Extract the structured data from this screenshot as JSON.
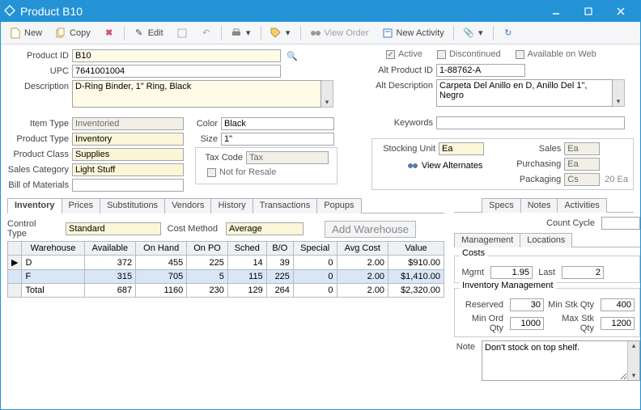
{
  "window": {
    "title": "Product B10"
  },
  "toolbar": {
    "new_": "New",
    "copy": "Copy",
    "edit": "Edit",
    "view_order": "View Order",
    "new_activity": "New Activity"
  },
  "labels": {
    "product_id": "Product ID",
    "upc": "UPC",
    "description": "Description",
    "item_type": "Item Type",
    "product_type": "Product Type",
    "product_class": "Product Class",
    "sales_category": "Sales Category",
    "bill_of_materials": "Bill of Materials",
    "color": "Color",
    "size": "Size",
    "tax_code": "Tax Code",
    "not_for_resale": "Not for Resale",
    "alt_product_id": "Alt Product ID",
    "alt_description": "Alt Description",
    "keywords": "Keywords",
    "active": "Active",
    "discontinued": "Discontinued",
    "avail_web": "Available on Web",
    "stocking_unit": "Stocking Unit",
    "sales": "Sales",
    "purchasing": "Purchasing",
    "packaging": "Packaging",
    "view_alternates": "View Alternates",
    "control_type": "Control Type",
    "cost_method": "Cost Method",
    "add_warehouse": "Add Warehouse",
    "count_cycle": "Count Cycle",
    "costs": "Costs",
    "mgmt": "Mgmt",
    "last": "Last",
    "inventory_mgmt": "Inventory Management",
    "reserved": "Reserved",
    "min_stk": "Min Stk Qty",
    "min_ord": "Min Ord Qty",
    "max_stk": "Max Stk Qty",
    "note": "Note"
  },
  "values": {
    "product_id": "B10",
    "upc": "7641001004",
    "description": "D-Ring Binder, 1\" Ring, Black",
    "item_type": "Inventoried",
    "product_type": "Inventory",
    "product_class": "Supplies",
    "sales_category": "Light Stuff",
    "bill_of_materials": "",
    "color": "Black",
    "size": "1\"",
    "tax_code": "Tax",
    "alt_product_id": "1-88762-A",
    "alt_description": "Carpeta Del Anillo en D, Anillo Del 1\", Negro",
    "keywords": "",
    "stocking_unit": "Ea",
    "sales": "Ea",
    "purchasing": "Ea",
    "packaging": "Cs",
    "packaging_qty": "20 Ea",
    "control_type": "Standard",
    "cost_method": "Average",
    "count_cycle": "",
    "mgmt": "1.95",
    "last": "2",
    "reserved": "30",
    "min_stk": "400",
    "min_ord": "1000",
    "max_stk": "1200",
    "note": "Don't stock on top shelf."
  },
  "checks": {
    "active": true,
    "discontinued": false,
    "avail_web": false,
    "not_for_resale": false
  },
  "tabs": [
    "Inventory",
    "Prices",
    "Substitutions",
    "Vendors",
    "History",
    "Transactions",
    "Popups"
  ],
  "right_tabs": [
    "Specs",
    "Notes",
    "Activities"
  ],
  "mgmt_tabs": [
    "Management",
    "Locations"
  ],
  "grid": {
    "cols": [
      "Warehouse",
      "Available",
      "On Hand",
      "On PO",
      "Sched",
      "B/O",
      "Special",
      "Avg Cost",
      "Value"
    ],
    "rows": [
      {
        "sel": "cur",
        "c": [
          "D",
          "372",
          "455",
          "225",
          "14",
          "39",
          "0",
          "2.00",
          "$910.00"
        ]
      },
      {
        "sel": "hi",
        "c": [
          "F",
          "315",
          "705",
          "5",
          "115",
          "225",
          "0",
          "2.00",
          "$1,410.00"
        ]
      },
      {
        "sel": "",
        "c": [
          "Total",
          "687",
          "1160",
          "230",
          "129",
          "264",
          "0",
          "2.00",
          "$2,320.00"
        ]
      }
    ]
  }
}
